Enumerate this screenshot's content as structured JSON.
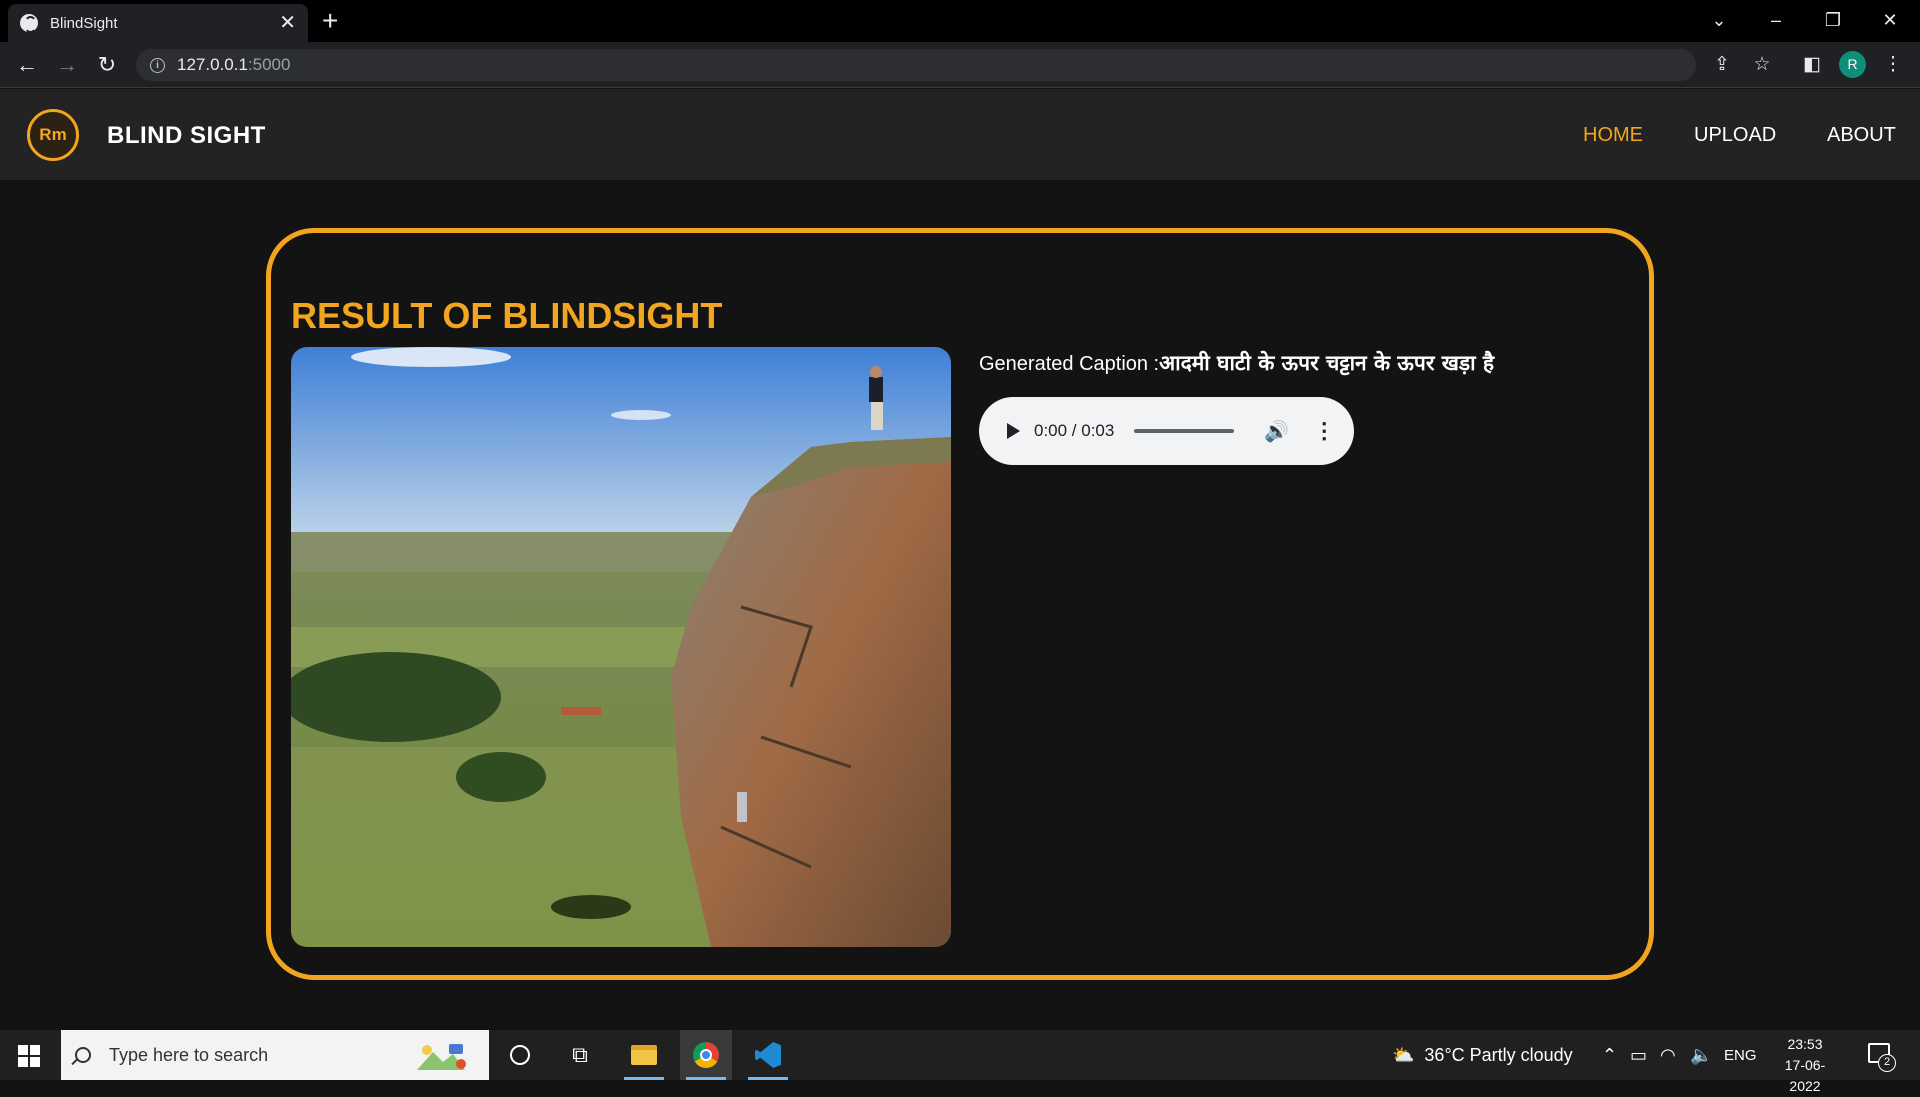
{
  "browser": {
    "tab_title": "BlindSight",
    "tab_close": "✕",
    "new_tab": "+",
    "url_host": "127.0.0.1",
    "url_port": ":5000",
    "avatar_initial": "R",
    "window_controls": {
      "tablist": "⌄",
      "minimize": "–",
      "restore": "❐",
      "close": "✕"
    },
    "nav": {
      "back": "←",
      "forward": "→",
      "reload": "↻"
    }
  },
  "app": {
    "logo_text": "Rm",
    "brand": "BLIND SIGHT",
    "nav": [
      {
        "label": "HOME",
        "active": true
      },
      {
        "label": "UPLOAD",
        "active": false
      },
      {
        "label": "ABOUT",
        "active": false
      }
    ]
  },
  "result": {
    "title": "RESULT OF BLINDSIGHT",
    "image_alt": "Man standing on top of a rocky cliff above a valley",
    "caption_label": "Generated Caption :",
    "caption_text": "आदमी घाटी के ऊपर चट्टान के ऊपर खड़ा है",
    "audio": {
      "current": "0:00",
      "duration": "0:03",
      "time_display": "0:00 / 0:03",
      "progress": 0
    }
  },
  "taskbar": {
    "search_placeholder": "Type here to search",
    "weather": "36°C  Partly cloudy",
    "language": "ENG",
    "time": "23:53",
    "date": "17-06-2022",
    "notification_count": "2"
  },
  "colors": {
    "accent": "#f2a51f",
    "page_bg": "#131313",
    "header_bg": "#232323"
  }
}
